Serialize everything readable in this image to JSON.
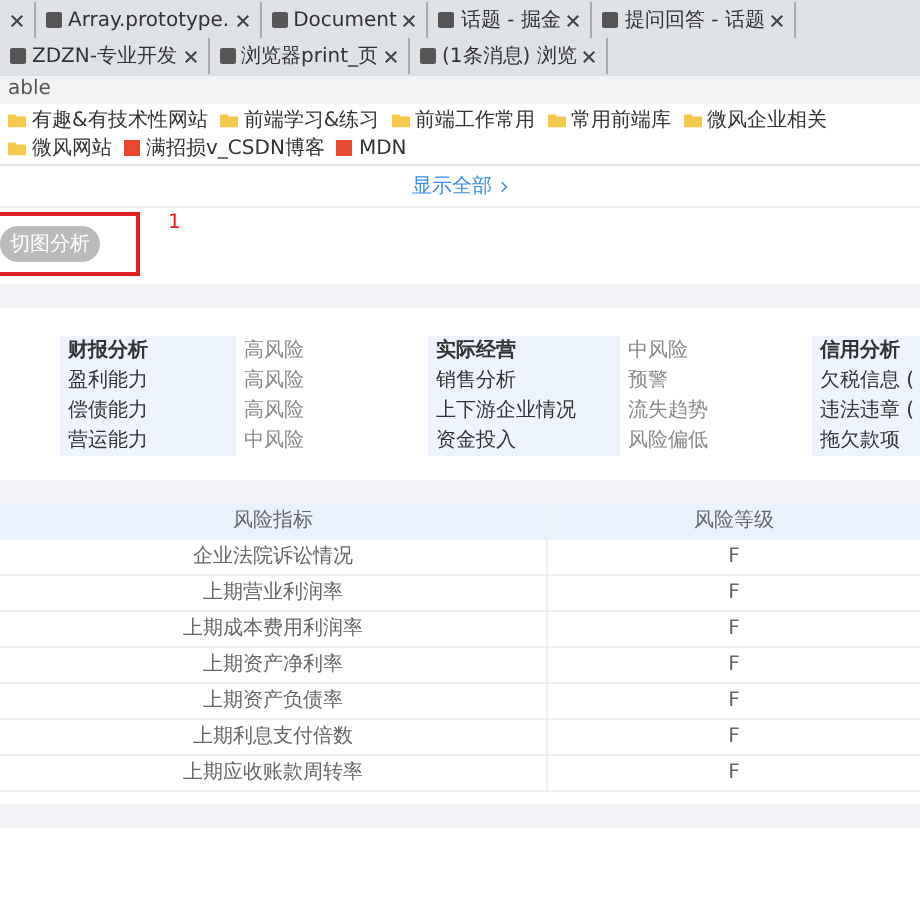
{
  "browser": {
    "tabs": [
      {
        "kind": "cut"
      },
      {
        "kind": "full",
        "title": "Array.prototype."
      },
      {
        "kind": "full",
        "title": "Document"
      },
      {
        "kind": "full",
        "title": "话题 - 掘金"
      },
      {
        "kind": "full",
        "title": "提问回答 - 话题"
      },
      {
        "kind": "full",
        "title": "ZDZN-专业开发"
      },
      {
        "kind": "full",
        "title": "浏览器print_页"
      },
      {
        "kind": "full",
        "title": "(1条消息) 浏览"
      }
    ],
    "address": "able",
    "bookmarks": [
      {
        "label": "有趣&有技术性网站",
        "kind": "folder"
      },
      {
        "label": "前端学习&练习",
        "kind": "folder"
      },
      {
        "label": "前端工作常用",
        "kind": "folder"
      },
      {
        "label": "常用前端库",
        "kind": "folder"
      },
      {
        "label": "微风企业相关",
        "kind": "folder"
      },
      {
        "label": "微风网站",
        "kind": "folder"
      },
      {
        "label": "满招损v_CSDN博客",
        "kind": "site"
      },
      {
        "label": "MDN",
        "kind": "site"
      }
    ]
  },
  "show_all": "显示全部",
  "analysis_button": "切图分析",
  "marker": "1",
  "grid": {
    "rows": [
      [
        {
          "text": "财报分析",
          "kind": "heading"
        },
        {
          "text": "高风险",
          "kind": "value"
        },
        {
          "text": "实际经营",
          "kind": "heading"
        },
        {
          "text": "中风险",
          "kind": "value"
        },
        {
          "text": "信用分析",
          "kind": "heading"
        }
      ],
      [
        {
          "text": "盈利能力",
          "kind": "label"
        },
        {
          "text": "高风险",
          "kind": "value"
        },
        {
          "text": "销售分析",
          "kind": "label"
        },
        {
          "text": "预警",
          "kind": "value"
        },
        {
          "text": "欠税信息 (",
          "kind": "label"
        }
      ],
      [
        {
          "text": "偿债能力",
          "kind": "label"
        },
        {
          "text": "高风险",
          "kind": "value"
        },
        {
          "text": "上下游企业情况",
          "kind": "label"
        },
        {
          "text": "流失趋势",
          "kind": "value"
        },
        {
          "text": "违法违章 (",
          "kind": "label"
        }
      ],
      [
        {
          "text": "营运能力",
          "kind": "label"
        },
        {
          "text": "中风险",
          "kind": "value"
        },
        {
          "text": "资金投入",
          "kind": "label"
        },
        {
          "text": "风险偏低",
          "kind": "value"
        },
        {
          "text": "拖欠款项",
          "kind": "label"
        }
      ]
    ]
  },
  "table": {
    "columns": [
      "风险指标",
      "风险等级"
    ],
    "rows": [
      [
        "企业法院诉讼情况",
        "F"
      ],
      [
        "上期营业利润率",
        "F"
      ],
      [
        "上期成本费用利润率",
        "F"
      ],
      [
        "上期资产净利率",
        "F"
      ],
      [
        "上期资产负债率",
        "F"
      ],
      [
        "上期利息支付倍数",
        "F"
      ],
      [
        "上期应收账款周转率",
        "F"
      ]
    ]
  }
}
